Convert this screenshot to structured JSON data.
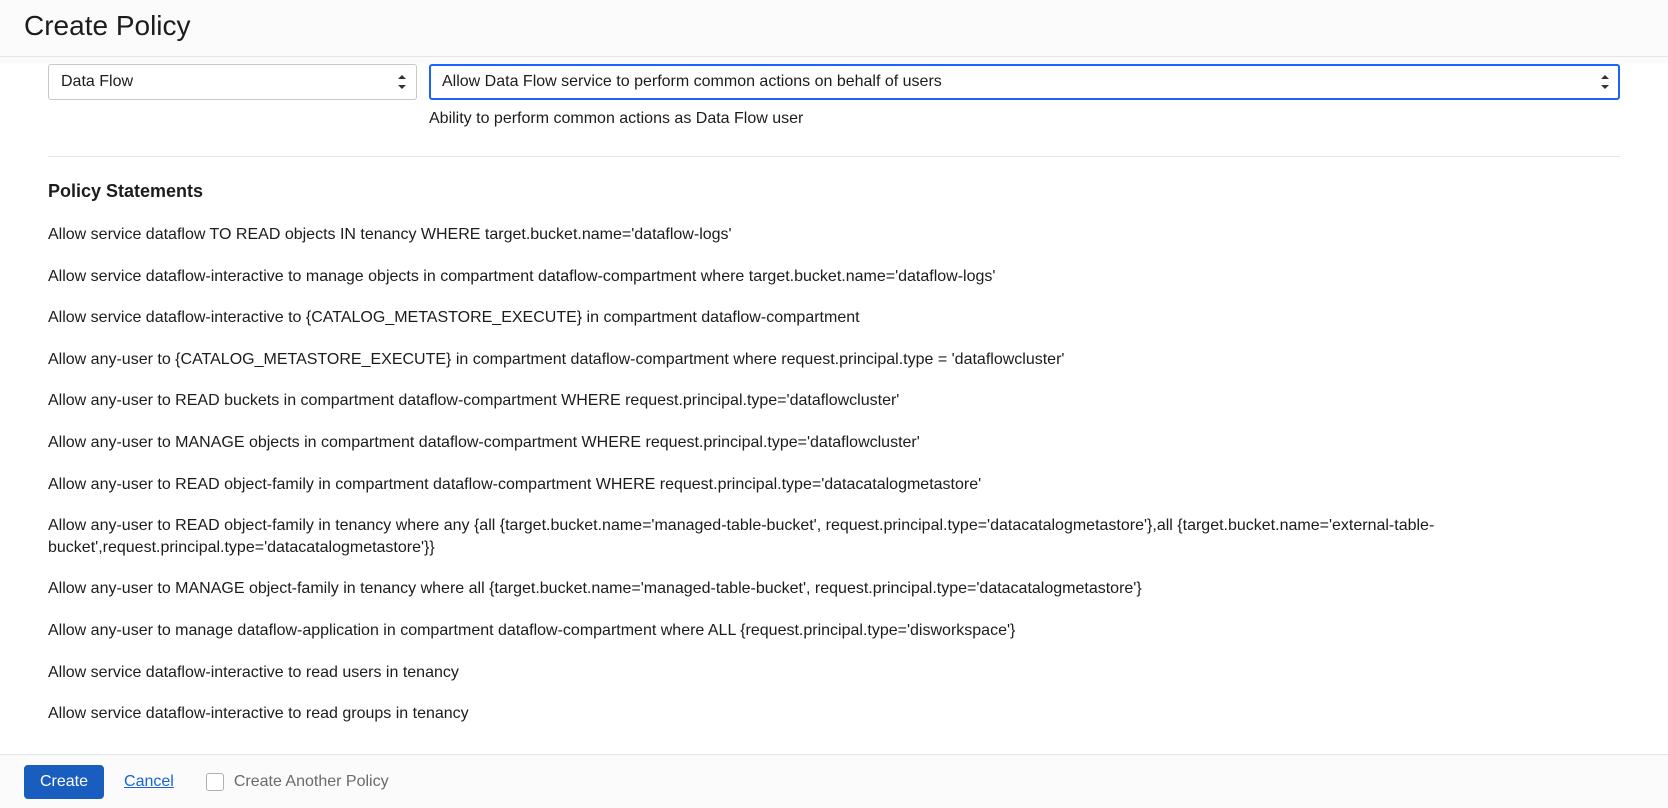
{
  "header": {
    "title": "Create Policy"
  },
  "selects": {
    "service": {
      "value": "Data Flow"
    },
    "action": {
      "value": "Allow Data Flow service to perform common actions on behalf of users",
      "helper": "Ability to perform common actions as Data Flow user"
    }
  },
  "section": {
    "title": "Policy Statements"
  },
  "statements": [
    "Allow service dataflow TO READ objects IN tenancy WHERE target.bucket.name='dataflow-logs'",
    "Allow service dataflow-interactive to manage objects in compartment dataflow-compartment where target.bucket.name='dataflow-logs'",
    "Allow service dataflow-interactive to {CATALOG_METASTORE_EXECUTE} in compartment dataflow-compartment",
    "Allow any-user to {CATALOG_METASTORE_EXECUTE} in compartment dataflow-compartment where request.principal.type = 'dataflowcluster'",
    "Allow any-user to READ buckets in compartment dataflow-compartment WHERE request.principal.type='dataflowcluster'",
    "Allow any-user to MANAGE objects in compartment dataflow-compartment WHERE request.principal.type='dataflowcluster'",
    "Allow any-user to READ object-family in compartment dataflow-compartment WHERE request.principal.type='datacatalogmetastore'",
    "Allow any-user to READ object-family in tenancy where any {all {target.bucket.name='managed-table-bucket', request.principal.type='datacatalogmetastore'},all {target.bucket.name='external-table-bucket',request.principal.type='datacatalogmetastore'}}",
    "Allow any-user to MANAGE object-family in tenancy where all {target.bucket.name='managed-table-bucket', request.principal.type='datacatalogmetastore'}",
    "Allow any-user to manage dataflow-application in compartment dataflow-compartment where ALL {request.principal.type='disworkspace'}",
    "Allow service dataflow-interactive to read users in tenancy",
    "Allow service dataflow-interactive to read groups in tenancy"
  ],
  "footer": {
    "create": "Create",
    "cancel": "Cancel",
    "another": "Create Another Policy"
  }
}
